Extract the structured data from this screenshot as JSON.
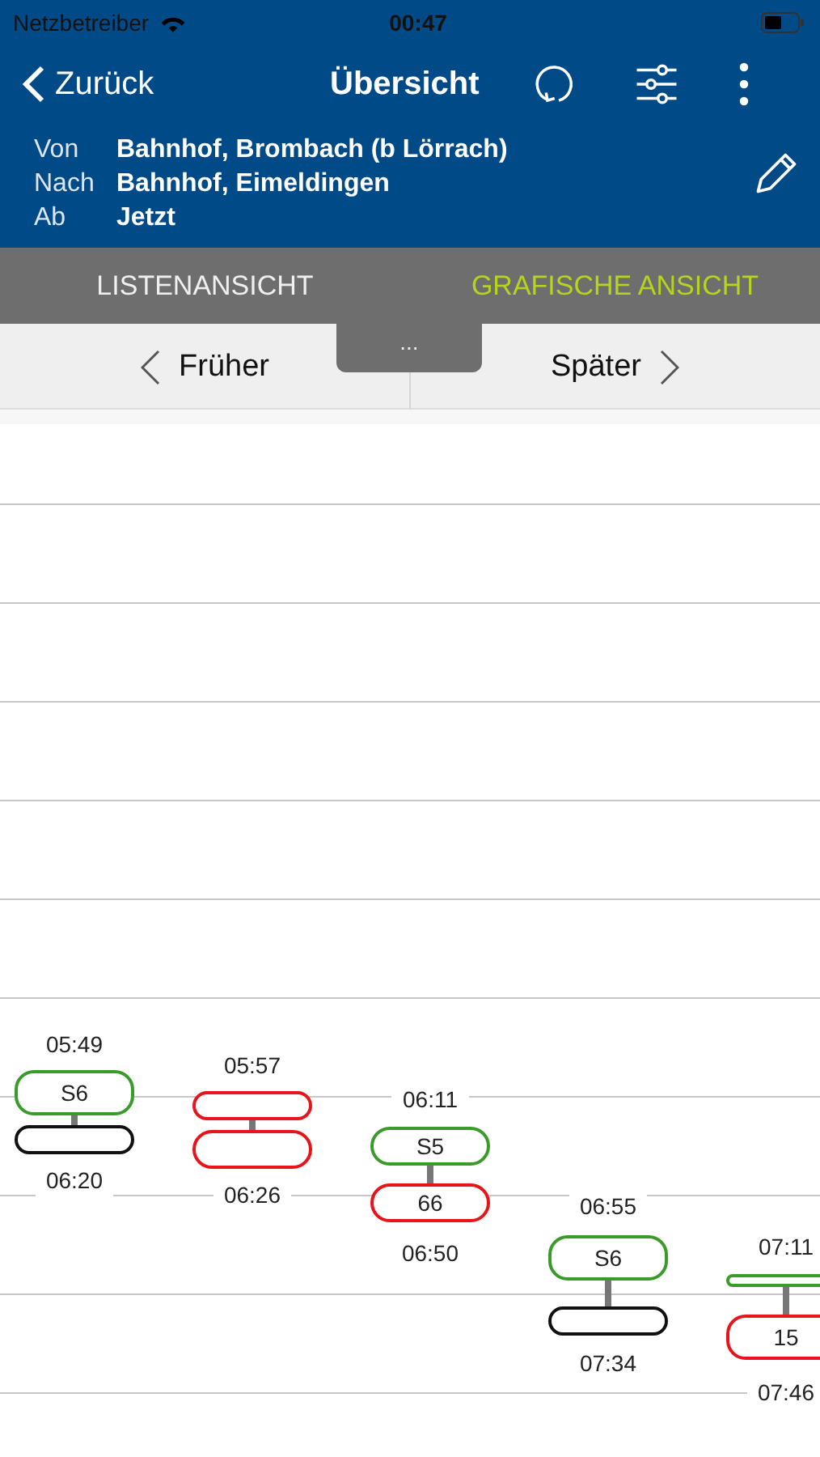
{
  "status_bar": {
    "carrier": "Netzbetreiber",
    "time": "00:47"
  },
  "nav": {
    "back": "Zurück",
    "title": "Übersicht"
  },
  "route": [
    {
      "label": "Von",
      "value": "Bahnhof, Brombach (b Lörrach)"
    },
    {
      "label": "Nach",
      "value": "Bahnhof, Eimeldingen"
    },
    {
      "label": "Ab",
      "value": "Jetzt"
    }
  ],
  "tabs": [
    {
      "label": "LISTENANSICHT",
      "selected": false
    },
    {
      "label": "GRAFISCHE ANSICHT",
      "selected": true
    }
  ],
  "handle": "...",
  "paging": {
    "earlier": "Früher",
    "later": "Später"
  },
  "connections": [
    {
      "departure": "05:49",
      "arrival": "06:20",
      "legs": [
        {
          "label": "S6",
          "color": "#3a9a2a"
        },
        {
          "color": "#111111"
        }
      ]
    },
    {
      "departure": "05:57",
      "arrival": "06:26",
      "legs": [
        {
          "color": "#e8141a"
        },
        {
          "color": "#e8141a"
        }
      ]
    },
    {
      "departure": "06:11",
      "arrival": "06:50",
      "legs": [
        {
          "label": "S5",
          "color": "#3a9a2a"
        },
        {
          "label": "66",
          "color": "#e8141a"
        }
      ]
    },
    {
      "departure": "06:55",
      "arrival": "07:34",
      "legs": [
        {
          "label": "S6",
          "color": "#3a9a2a"
        },
        {
          "color": "#111111"
        }
      ]
    },
    {
      "departure": "07:11",
      "arrival": "07:46",
      "legs": [
        {
          "color": "#3a9a2a"
        },
        {
          "label": "15",
          "color": "#e8141a"
        }
      ]
    }
  ]
}
